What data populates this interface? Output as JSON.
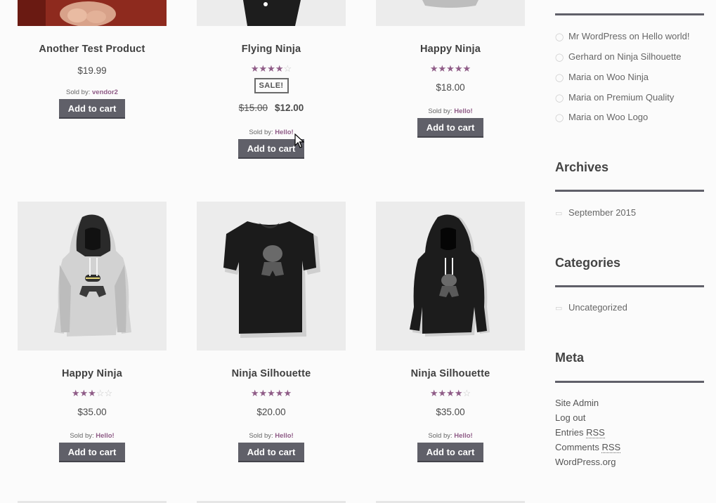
{
  "products": [
    {
      "title": "Another Test Product",
      "price": "$19.99",
      "sold_by_label": "Sold by:",
      "vendor": "vendor2",
      "button": "Add to cart"
    },
    {
      "title": "Flying Ninja",
      "rating": 4,
      "sale_badge": "SALE!",
      "old_price": "$15.00",
      "price": "$12.00",
      "sold_by_label": "Sold by:",
      "vendor": "Hello!",
      "button": "Add to cart"
    },
    {
      "title": "Happy Ninja",
      "rating": 5,
      "price": "$18.00",
      "sold_by_label": "Sold by:",
      "vendor": "Hello!",
      "button": "Add to cart"
    },
    {
      "title": "Happy Ninja",
      "rating": 3,
      "price": "$35.00",
      "sold_by_label": "Sold by:",
      "vendor": "Hello!",
      "button": "Add to cart",
      "image": "grey-hoodie"
    },
    {
      "title": "Ninja Silhouette",
      "rating": 5,
      "price": "$20.00",
      "sold_by_label": "Sold by:",
      "vendor": "Hello!",
      "button": "Add to cart",
      "image": "black-tshirt"
    },
    {
      "title": "Ninja Silhouette",
      "rating": 4.5,
      "price": "$35.00",
      "sold_by_label": "Sold by:",
      "vendor": "Hello!",
      "button": "Add to cart",
      "image": "black-hoodie"
    }
  ],
  "sidebar": {
    "recent_comments": [
      {
        "author": "Mr WordPress",
        "on": "on",
        "post": "Hello world!"
      },
      {
        "author": "Gerhard",
        "on": "on",
        "post": "Ninja Silhouette"
      },
      {
        "author": "Maria",
        "on": "on",
        "post": "Woo Ninja"
      },
      {
        "author": "Maria",
        "on": "on",
        "post": "Premium Quality"
      },
      {
        "author": "Maria",
        "on": "on",
        "post": "Woo Logo"
      }
    ],
    "archives": {
      "title": "Archives",
      "items": [
        "September 2015"
      ]
    },
    "categories": {
      "title": "Categories",
      "items": [
        "Uncategorized"
      ]
    },
    "meta": {
      "title": "Meta",
      "site_admin": "Site Admin",
      "log_out": "Log out",
      "entries_prefix": "Entries",
      "comments_prefix": "Comments",
      "rss": "RSS",
      "wordpress_org": "WordPress.org"
    }
  },
  "colors": {
    "accent": "#8f5c87",
    "button": "#606069",
    "bar": "#606069"
  },
  "icons": {
    "comment": "comment-bubble-icon",
    "folder": "folder-icon",
    "cursor": "mouse-pointer-icon"
  }
}
